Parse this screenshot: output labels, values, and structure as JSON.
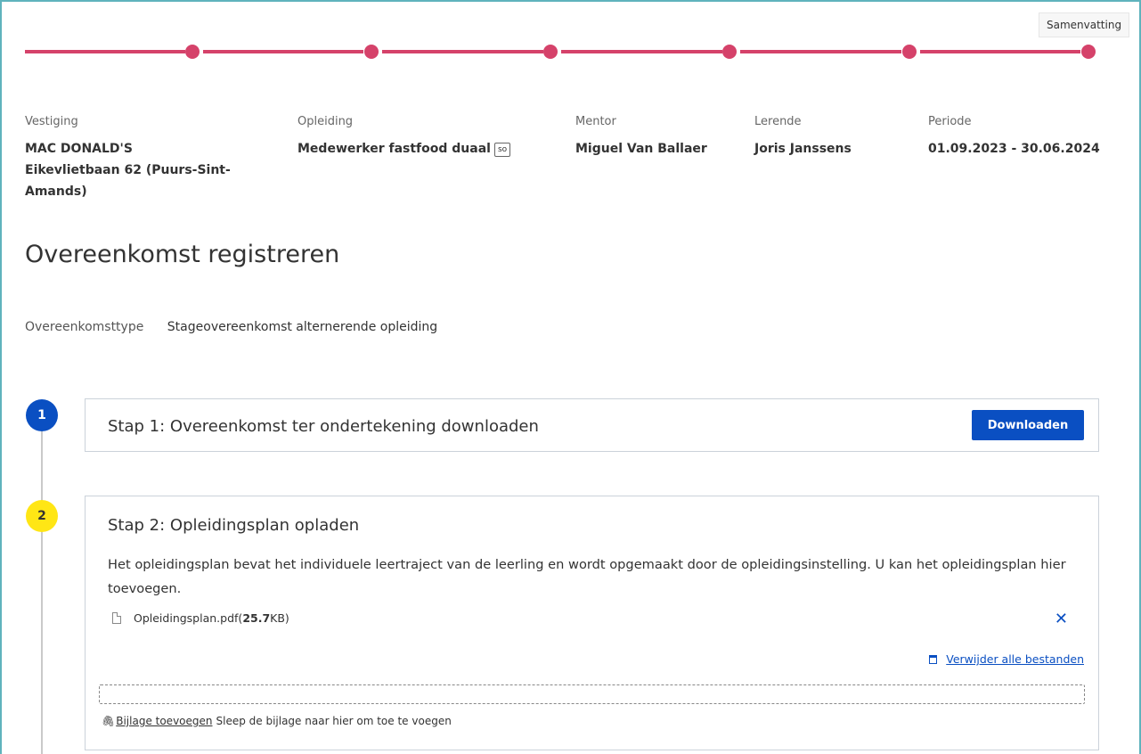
{
  "progress": {
    "tooltip": "Samenvatting",
    "steps_total": 6,
    "steps_completed": 6
  },
  "info": {
    "vestiging": {
      "label": "Vestiging",
      "value_line1": "MAC DONALD'S",
      "value_line2": "Eikevlietbaan 62 (Puurs-Sint-",
      "value_line3": "Amands)"
    },
    "opleiding": {
      "label": "Opleiding",
      "value": "Medewerker fastfood duaal",
      "badge": "so"
    },
    "mentor": {
      "label": "Mentor",
      "value": "Miguel Van Ballaer"
    },
    "lerende": {
      "label": "Lerende",
      "value": "Joris Janssens"
    },
    "periode": {
      "label": "Periode",
      "value": "01.09.2023 - 30.06.2024"
    }
  },
  "page_title": "Overeenkomst registreren",
  "agreement": {
    "label": "Overeenkomsttype",
    "value": "Stageovereenkomst alternerende opleiding"
  },
  "step1": {
    "number": "1",
    "title": "Stap 1: Overeenkomst ter ondertekening downloaden",
    "button": "Downloaden",
    "color": "#0a4fc2"
  },
  "step2": {
    "number": "2",
    "title": "Stap 2: Opleidingsplan opladen",
    "description": "Het opleidingsplan bevat het individuele leertraject van de leerling en wordt opgemaakt door de opleidingsinstelling. U kan het opleidingsplan hier toevoegen.",
    "file": {
      "name": "Opleidingsplan.pdf",
      "size_open": " (",
      "size_value": "25.7",
      "size_unit": " KB)"
    },
    "remove_all": "Verwijder alle bestanden",
    "attach_link": "Bijlage toevoegen",
    "attach_hint": "Sleep de bijlage naar hier om toe te voegen",
    "color": "#ffe615"
  },
  "icons": {
    "file": "file-icon",
    "close": "close-icon",
    "trash": "trash-icon",
    "paperclip": "paperclip-icon"
  },
  "colors": {
    "progress": "#d5426a",
    "primary": "#0a4fc2",
    "frame": "#5fb3bd"
  }
}
